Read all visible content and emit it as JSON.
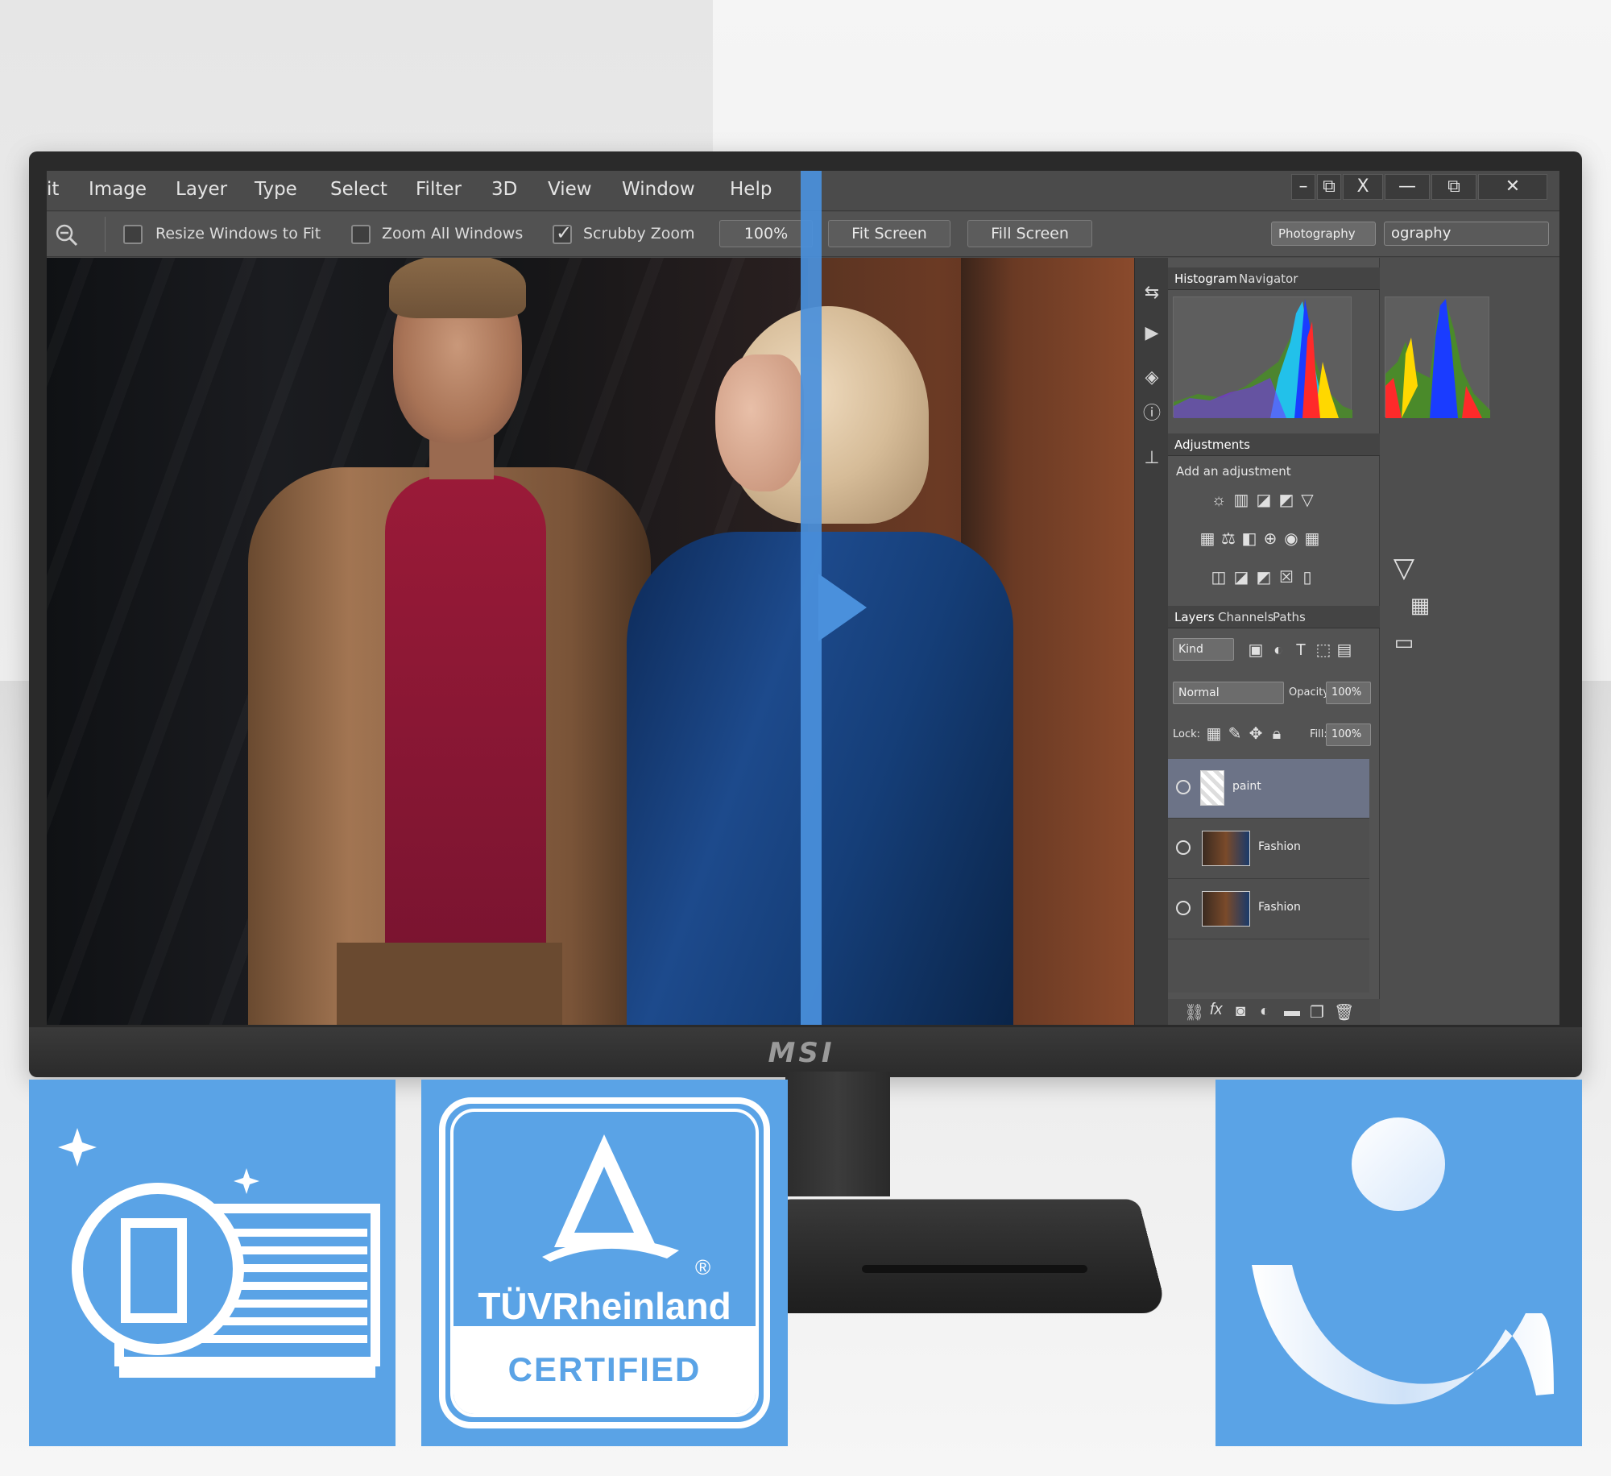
{
  "menu": {
    "items": [
      "it",
      "Image",
      "Layer",
      "Type",
      "Select",
      "Filter",
      "3D",
      "View",
      "Window",
      "Help"
    ]
  },
  "window_buttons": {
    "minimize": "–",
    "restore": "⧉",
    "close_small": "X",
    "minimize2": "—",
    "restore2": "⧉",
    "close": "✕"
  },
  "options_bar": {
    "resize_windows_label": "Resize Windows to Fit",
    "zoom_all_label": "Zoom All Windows",
    "scrubby_zoom_label": "Scrubby Zoom",
    "zoom_level": "100%",
    "fit_screen": "Fit Screen",
    "fill_screen": "Fill Screen",
    "workspace_left": "Photography",
    "workspace_right": "ography",
    "resize_windows_checked": false,
    "zoom_all_checked": false,
    "scrubby_zoom_checked": true
  },
  "panels": {
    "histogram_tabs": [
      "Histogram",
      "Navigator"
    ],
    "adjustments_tab": "Adjustments",
    "add_adjustment": "Add an adjustment",
    "layers_tabs": [
      "Layers",
      "Channels",
      "Paths"
    ],
    "kind_filter": "Kind",
    "blend_mode": "Normal",
    "opacity_label": "Opacity:",
    "opacity_value": "100%",
    "lock_label": "Lock:",
    "fill_label": "Fill:",
    "fill_value": "100%",
    "layers": [
      {
        "name": "paint",
        "selected": true
      },
      {
        "name": "Fashion",
        "selected": false
      },
      {
        "name": "Fashion",
        "selected": false
      }
    ]
  },
  "monitor": {
    "brand": "MSI"
  },
  "badges": {
    "tuv_name": "TÜVRheinland",
    "tuv_certified": "CERTIFIED",
    "tuv_registered": "®"
  },
  "icons": {
    "zoom": "zoom-out-icon",
    "eye": "eye-icon",
    "anti_flicker": "anti-flicker-icon",
    "tuv_logo": "tuv-logo",
    "eye_care": "eye-care-icon"
  },
  "colors": {
    "accent": "#4a90dc",
    "badge": "#5aa3e6",
    "selected_layer": "#6c7387"
  }
}
